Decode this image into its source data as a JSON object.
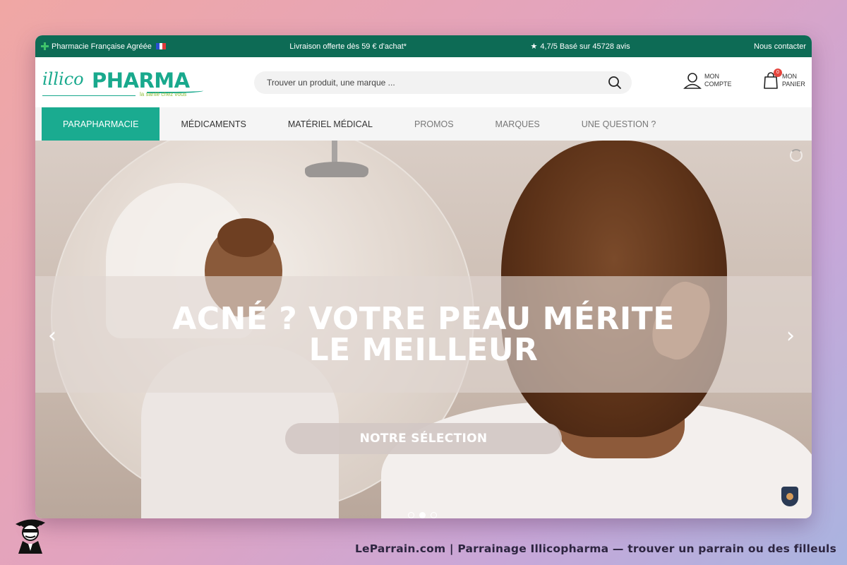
{
  "topbar": {
    "pharmacy": "Pharmacie Française Agréée",
    "delivery": "Livraison offerte dès 59 € d'achat*",
    "rating": "4,7/5 Basé sur 45728 avis",
    "contact": "Nous contacter"
  },
  "logo": {
    "part1": "illico",
    "part2": "PHARMA",
    "tagline": "la santé chez vous"
  },
  "search": {
    "placeholder": "Trouver un produit, une marque ..."
  },
  "account": {
    "line1": "MON",
    "line2": "COMPTE"
  },
  "cart": {
    "line1": "MON",
    "line2": "PANIER",
    "count": "0"
  },
  "nav": {
    "items": [
      {
        "label": "PARAPHARMACIE"
      },
      {
        "label": "MÉDICAMENTS"
      },
      {
        "label": "MATÉRIEL MÉDICAL"
      },
      {
        "label": "PROMOS"
      },
      {
        "label": "MARQUES"
      },
      {
        "label": "UNE QUESTION ?"
      }
    ]
  },
  "hero": {
    "title_line1": "ACNÉ ? VOTRE PEAU MÉRITE",
    "title_line2": "LE MEILLEUR",
    "cta": "NOTRE SÉLECTION",
    "slides": 3,
    "active_slide": 2
  },
  "footer": {
    "credit": "LeParrain.com | Parrainage Illicopharma — trouver un parrain ou des filleuls"
  },
  "colors": {
    "brand_green": "#0d6b55",
    "accent_teal": "#1aab90",
    "logo_lime": "#8dbf3b",
    "badge_red": "#e5443c"
  }
}
